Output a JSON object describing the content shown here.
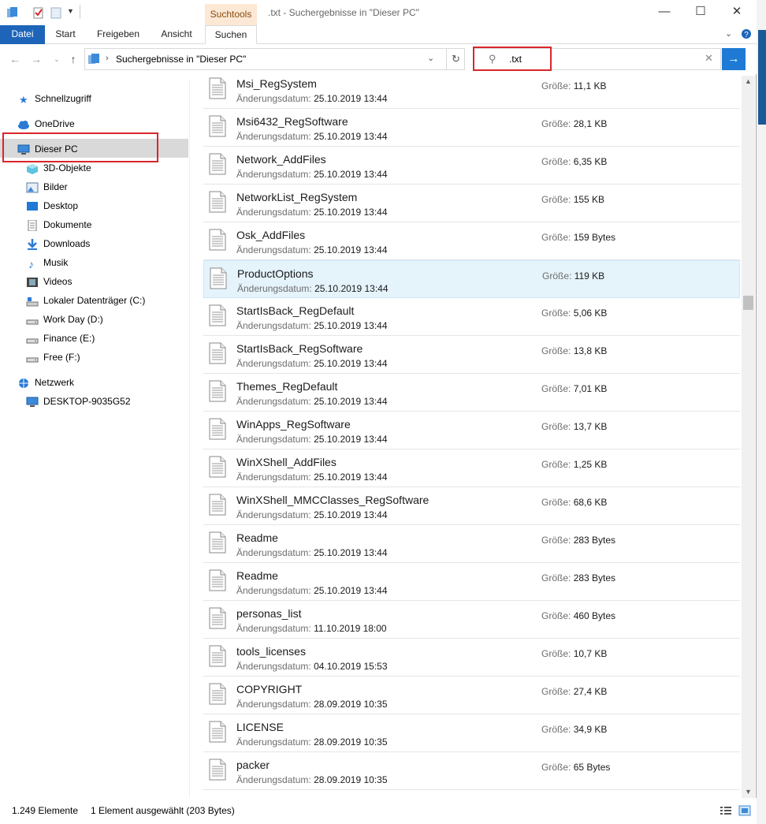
{
  "window": {
    "title": ".txt - Suchergebnisse in \"Dieser PC\"",
    "context_tab": "Suchtools"
  },
  "ribbon": {
    "tabs": [
      "Datei",
      "Start",
      "Freigeben",
      "Ansicht",
      "Suchen"
    ]
  },
  "address": {
    "path": "Suchergebnisse in \"Dieser PC\""
  },
  "search": {
    "value": ".txt"
  },
  "nav": {
    "items": [
      {
        "label": "Schnellzugriff",
        "icon": "star-icon"
      },
      {
        "label": "OneDrive",
        "icon": "cloud-icon"
      },
      {
        "label": "Dieser PC",
        "icon": "computer-icon"
      },
      {
        "label": "3D-Objekte",
        "icon": "cube-icon"
      },
      {
        "label": "Bilder",
        "icon": "pictures-icon"
      },
      {
        "label": "Desktop",
        "icon": "desktop-icon"
      },
      {
        "label": "Dokumente",
        "icon": "documents-icon"
      },
      {
        "label": "Downloads",
        "icon": "download-icon"
      },
      {
        "label": "Musik",
        "icon": "music-icon"
      },
      {
        "label": "Videos",
        "icon": "video-icon"
      },
      {
        "label": "Lokaler Datenträger (C:)",
        "icon": "system-drive-icon"
      },
      {
        "label": "Work Day (D:)",
        "icon": "drive-icon"
      },
      {
        "label": "Finance (E:)",
        "icon": "drive-icon"
      },
      {
        "label": "Free (F:)",
        "icon": "drive-icon"
      },
      {
        "label": "Netzwerk",
        "icon": "network-icon"
      },
      {
        "label": "DESKTOP-9035G52",
        "icon": "computer-icon"
      }
    ]
  },
  "labels": {
    "modified": "Änderungsdatum:",
    "size": "Größe:"
  },
  "files": [
    {
      "name": "Msi_RegSystem",
      "date": "25.10.2019 13:44",
      "size": "11,1 KB"
    },
    {
      "name": "Msi6432_RegSoftware",
      "date": "25.10.2019 13:44",
      "size": "28,1 KB"
    },
    {
      "name": "Network_AddFiles",
      "date": "25.10.2019 13:44",
      "size": "6,35 KB"
    },
    {
      "name": "NetworkList_RegSystem",
      "date": "25.10.2019 13:44",
      "size": "155 KB"
    },
    {
      "name": "Osk_AddFiles",
      "date": "25.10.2019 13:44",
      "size": "159 Bytes"
    },
    {
      "name": "ProductOptions",
      "date": "25.10.2019 13:44",
      "size": "119 KB"
    },
    {
      "name": "StartIsBack_RegDefault",
      "date": "25.10.2019 13:44",
      "size": "5,06 KB"
    },
    {
      "name": "StartIsBack_RegSoftware",
      "date": "25.10.2019 13:44",
      "size": "13,8 KB"
    },
    {
      "name": "Themes_RegDefault",
      "date": "25.10.2019 13:44",
      "size": "7,01 KB"
    },
    {
      "name": "WinApps_RegSoftware",
      "date": "25.10.2019 13:44",
      "size": "13,7 KB"
    },
    {
      "name": "WinXShell_AddFiles",
      "date": "25.10.2019 13:44",
      "size": "1,25 KB"
    },
    {
      "name": "WinXShell_MMCClasses_RegSoftware",
      "date": "25.10.2019 13:44",
      "size": "68,6 KB"
    },
    {
      "name": "Readme",
      "date": "25.10.2019 13:44",
      "size": "283 Bytes"
    },
    {
      "name": "Readme",
      "date": "25.10.2019 13:44",
      "size": "283 Bytes"
    },
    {
      "name": "personas_list",
      "date": "11.10.2019 18:00",
      "size": "460 Bytes"
    },
    {
      "name": "tools_licenses",
      "date": "04.10.2019 15:53",
      "size": "10,7 KB"
    },
    {
      "name": "COPYRIGHT",
      "date": "28.09.2019 10:35",
      "size": "27,4 KB"
    },
    {
      "name": "LICENSE",
      "date": "28.09.2019 10:35",
      "size": "34,9 KB"
    },
    {
      "name": "packer",
      "date": "28.09.2019 10:35",
      "size": "65 Bytes"
    }
  ],
  "status": {
    "count": "1.249 Elemente",
    "selection": "1 Element ausgewählt (203 Bytes)"
  },
  "colors": {
    "accent": "#1e7ad4",
    "highlight": "#d9262c",
    "selected_row": "#e5f3fb"
  }
}
